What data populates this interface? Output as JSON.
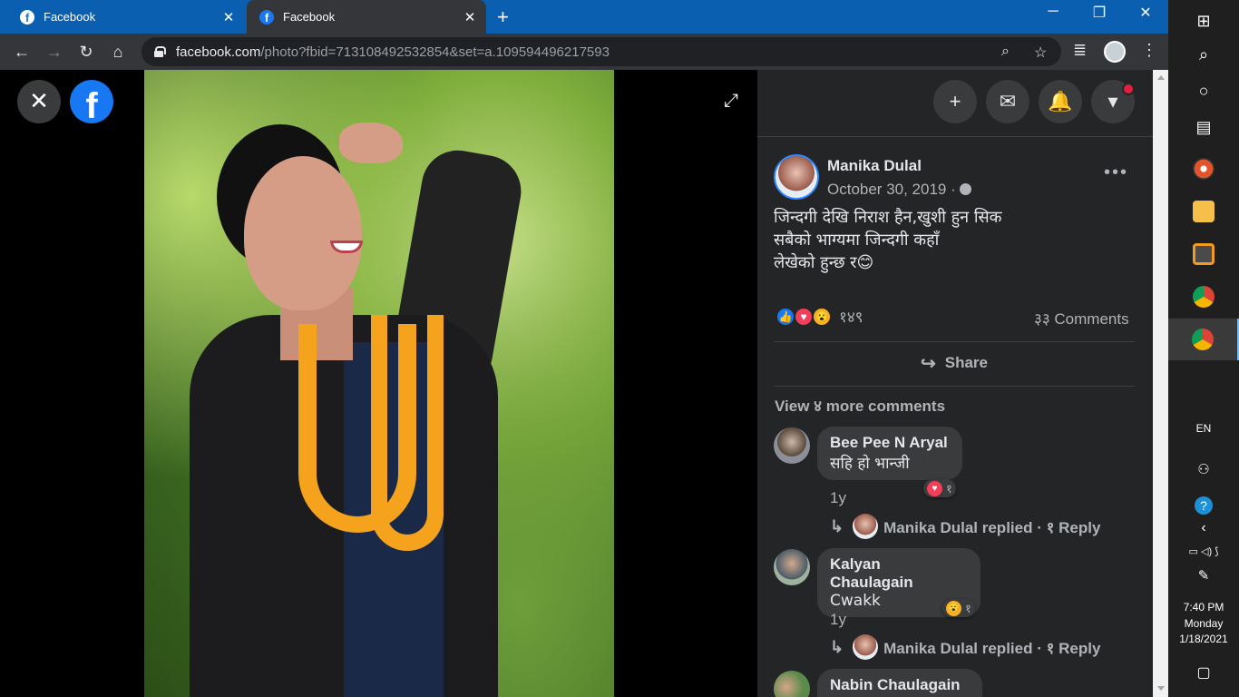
{
  "browser": {
    "tabs": [
      {
        "title": "Facebook",
        "active": false
      },
      {
        "title": "Facebook",
        "active": true
      }
    ],
    "url_host": "facebook.com",
    "url_path": "/photo?fbid=713108492532854&set=a.109594496217593"
  },
  "viewer": {
    "close_icon": "close-icon",
    "logo_letter": "f"
  },
  "post": {
    "author": "Manika Dulal",
    "date": "October 30, 2019 ·",
    "text": "जिन्दगी देखि निराश हैन,खुशी हुन सिक\nसबैको भाग्यमा जिन्दगी कहाँ\nलेखेको हुन्छ र😊",
    "reactions_count": "१४९",
    "comments_count": "३३ Comments",
    "share_label": "Share",
    "view_more": "View ४ more comments"
  },
  "comments": [
    {
      "name": "Bee Pee N Aryal",
      "text": "सहि हो भान्जी",
      "reaction_count": "१",
      "reaction_type": "love",
      "time": "1y",
      "reply_summary": "Manika Dulal replied · १ Reply"
    },
    {
      "name": "Kalyan Chaulagain",
      "text": "Cwakk",
      "reaction_count": "१",
      "reaction_type": "wow",
      "time": "1y",
      "reply_summary": "Manika Dulal replied · १ Reply"
    },
    {
      "name": "Nabin Chaulagain"
    }
  ],
  "taskbar": {
    "lang": "EN",
    "time": "7:40 PM",
    "day": "Monday",
    "date": "1/18/2021"
  },
  "colors": {
    "accent": "#1877f2",
    "panel_bg": "#242526",
    "bubble_bg": "#3a3b3c",
    "notification_badge": "#e41e3f"
  }
}
